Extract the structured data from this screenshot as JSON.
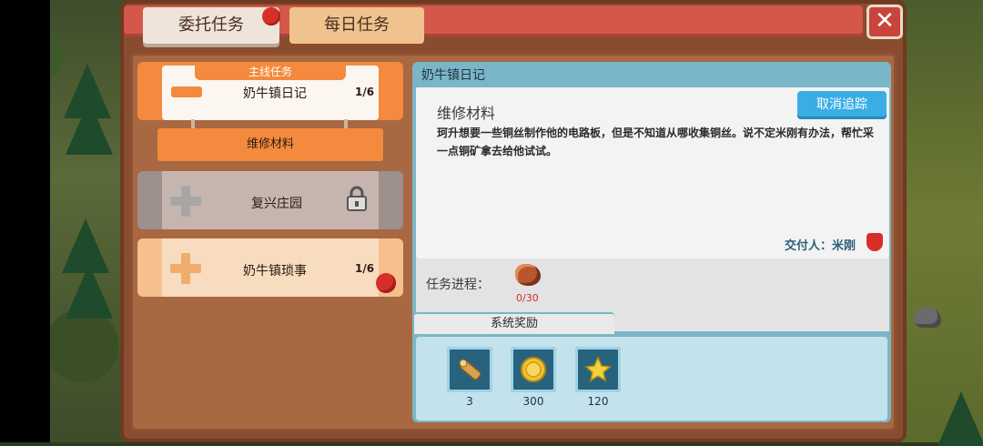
{
  "tabs": [
    {
      "label": "委托任务",
      "active": true,
      "has_badge": true
    },
    {
      "label": "每日任务",
      "active": false,
      "has_badge": false
    }
  ],
  "quests": {
    "main": {
      "tag": "主线任务",
      "title": "奶牛镇日记",
      "progress": "1/6",
      "sub_item": "维修材料"
    },
    "locked": {
      "title": "复兴庄园"
    },
    "side": {
      "title": "奶牛镇琐事",
      "progress": "1/6",
      "has_badge": true
    }
  },
  "detail": {
    "header": "奶牛镇日记",
    "quest_name": "维修材料",
    "untrack_button": "取消追踪",
    "description": "珂升想要一些铜丝制作他的电路板，但是不知道从哪收集铜丝。说不定米刚有办法，帮忙采一点铜矿拿去给他试试。",
    "giver_label": "交付人：米刚",
    "progress_label": "任务进程：",
    "progress_item": {
      "icon": "copper-ore-icon",
      "count": "0/30"
    },
    "reward_tab": "系统奖励",
    "rewards": [
      {
        "icon": "wood-log-icon",
        "value": "3"
      },
      {
        "icon": "gold-coin-icon",
        "value": "300"
      },
      {
        "icon": "star-icon",
        "value": "120"
      }
    ]
  },
  "colors": {
    "accent_orange": "#f48a3d",
    "title_red": "#d3574a",
    "panel_blue": "#7ab6c7",
    "button_blue": "#3aaee4",
    "badge_red": "#d62f2a"
  }
}
